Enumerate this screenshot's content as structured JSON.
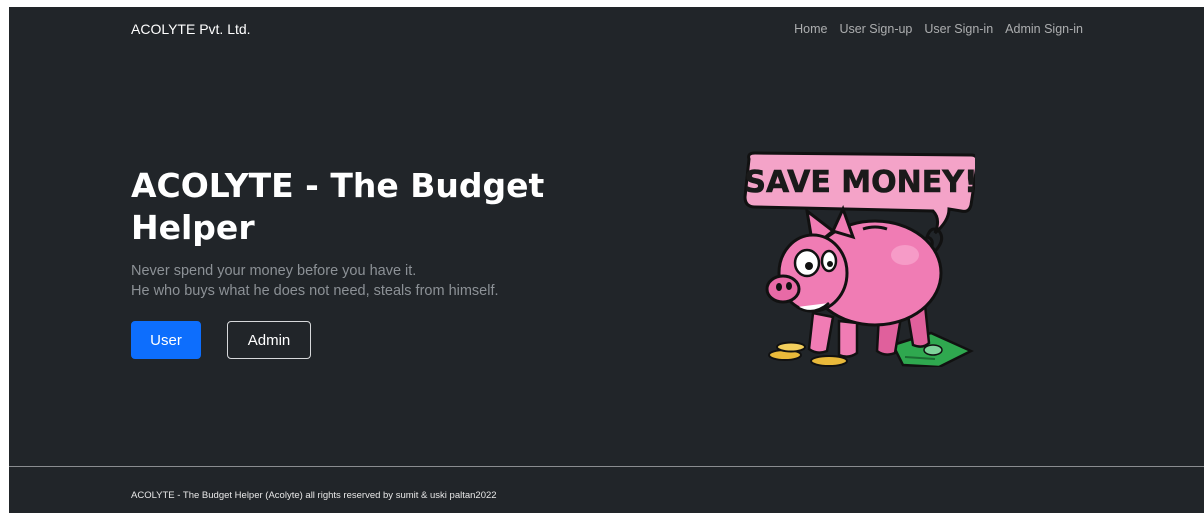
{
  "navbar": {
    "brand": "ACOLYTE Pvt. Ltd.",
    "links": [
      {
        "label": "Home"
      },
      {
        "label": "User Sign-up"
      },
      {
        "label": "User Sign-in"
      },
      {
        "label": "Admin Sign-in"
      }
    ]
  },
  "hero": {
    "title": "ACOLYTE - The Budget Helper",
    "lead_lines": [
      "Never spend your money before you have it.",
      "He who buys what he does not need, steals from himself."
    ],
    "buttons": {
      "user_label": "User",
      "admin_label": "Admin"
    },
    "illustration": {
      "icon": "piggy-bank-illustration",
      "bubble_text": "SAVE MONEY!"
    }
  },
  "footer": {
    "text": "ACOLYTE - The Budget Helper (Acolyte) all rights reserved by sumit & uski paltan2022"
  },
  "colors": {
    "background": "#212529",
    "primary": "#0d6efd",
    "piggy_pink": "#f07cb4",
    "bubble_pink": "#f4a3c8",
    "cash_green": "#2fa84f",
    "coin_gold": "#e9b93a"
  }
}
